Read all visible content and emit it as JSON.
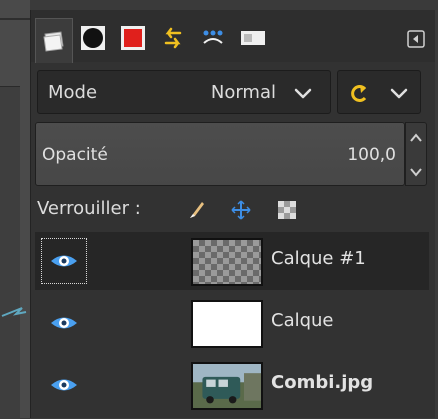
{
  "tabs": [
    {
      "name": "layers-tab",
      "icon": "layers-icon"
    },
    {
      "name": "channels-tab",
      "icon": "channels-icon"
    },
    {
      "name": "paths-tab",
      "icon": "paths-icon"
    },
    {
      "name": "undo-history-tab",
      "icon": "undo-history-icon"
    },
    {
      "name": "pointer-tab",
      "icon": "pointer-icon"
    },
    {
      "name": "images-tab",
      "icon": "images-icon"
    }
  ],
  "mode": {
    "label": "Mode",
    "value": "Normal"
  },
  "opacity": {
    "label": "Opacité",
    "value": "100,0"
  },
  "lock": {
    "label": "Verrouiller :"
  },
  "layers": [
    {
      "name": "Calque #1",
      "bold": false,
      "thumb": "transparent",
      "visible": true,
      "selected": true
    },
    {
      "name": "Calque",
      "bold": false,
      "thumb": "white",
      "visible": true,
      "selected": false
    },
    {
      "name": "Combi.jpg",
      "bold": true,
      "thumb": "photo",
      "visible": true,
      "selected": false
    }
  ],
  "colors": {
    "accent_blue": "#3d8ee6",
    "eye_blue": "#4aa0f0",
    "composite_yellow": "#f0c020",
    "panel_bg": "#323232"
  }
}
